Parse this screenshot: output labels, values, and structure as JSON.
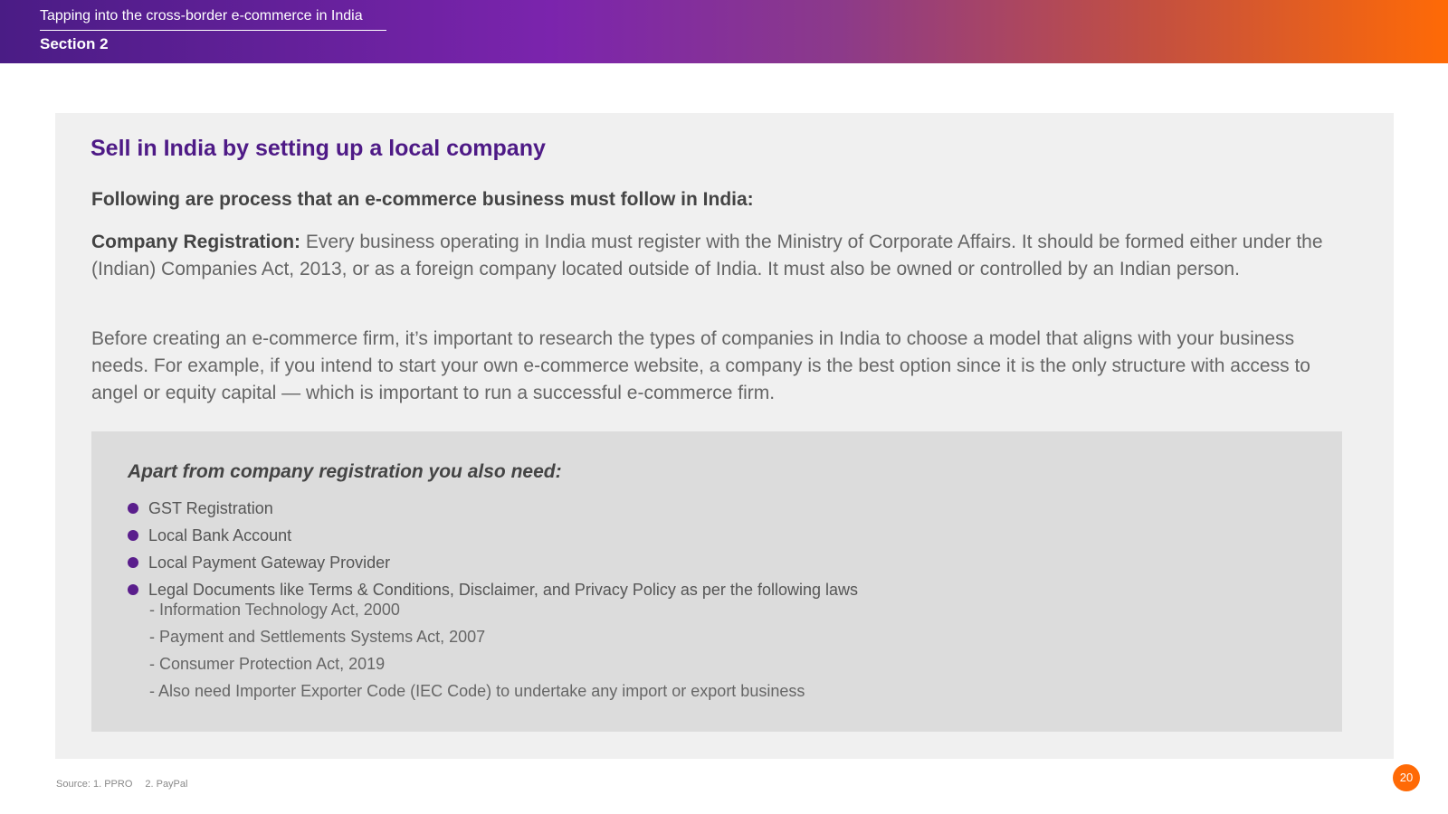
{
  "header": {
    "title": "Tapping into the cross-border e-commerce in India",
    "section": "Section 2"
  },
  "card": {
    "title": "Sell in India by setting up a local company",
    "subtitle": "Following are process that an e-commerce business must follow in India:",
    "registration_label": "Company Registration:",
    "registration_text": " Every business operating in India must register with the Ministry of Corporate Affairs. It should be formed either under the (Indian) Companies Act, 2013, or as a foreign company located outside of India. It must also be owned or controlled by an Indian person.",
    "research_text": "Before creating an e-commerce firm, it’s important to research the types of companies in India to choose a model that aligns with your business needs. For example, if you intend to start your own e-commerce website, a company is the best option since it is the only structure with access to angel or equity capital — which is important to run a successful e-commerce firm."
  },
  "requirements": {
    "heading": "Apart from company registration you also need:",
    "items": [
      "GST Registration",
      "Local Bank Account",
      "Local Payment Gateway Provider",
      "Legal Documents like Terms & Conditions, Disclaimer, and Privacy Policy as per the following laws"
    ],
    "laws": [
      "- Information Technology Act, 2000",
      "- Payment and Settlements Systems Act, 2007",
      "- Consumer Protection Act, 2019",
      "- Also need Importer Exporter Code (IEC Code) to undertake any import or export business"
    ]
  },
  "footer": {
    "source_1": "Source: 1. PPRO",
    "source_2": "2. PayPal",
    "page_number": "20"
  },
  "colors": {
    "title_purple": "#4e1a86",
    "bullet_purple": "#5a1e8c",
    "accent_orange": "#ff6a06",
    "card_bg": "#f0f0f0",
    "inner_bg": "#dcdcdc"
  }
}
